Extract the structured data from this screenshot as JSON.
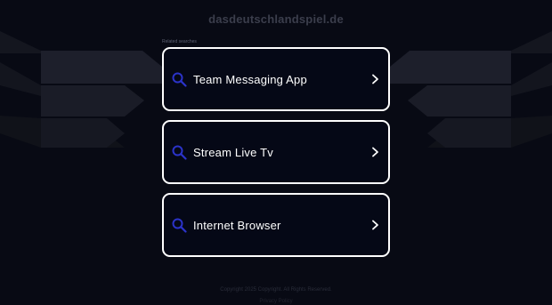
{
  "site": {
    "domain": "dasdeutschlandspiel.de"
  },
  "searches": {
    "heading": "Related searches",
    "items": [
      {
        "label": "Team Messaging App",
        "icon": "search-icon",
        "chevron": "chevron-right-icon"
      },
      {
        "label": "Stream Live Tv",
        "icon": "search-icon",
        "chevron": "chevron-right-icon"
      },
      {
        "label": "Internet Browser",
        "icon": "search-icon",
        "chevron": "chevron-right-icon"
      }
    ]
  },
  "footer": {
    "copyright": "Copyright 2025 Copyright. All Rights Reserved.",
    "privacy": "Privacy Policy"
  },
  "colors": {
    "background": "#080a14",
    "card_border": "#ffffff",
    "card_fill": "#050816",
    "icon_blue": "#2b33c9",
    "title_gray": "#3b3e4c"
  }
}
